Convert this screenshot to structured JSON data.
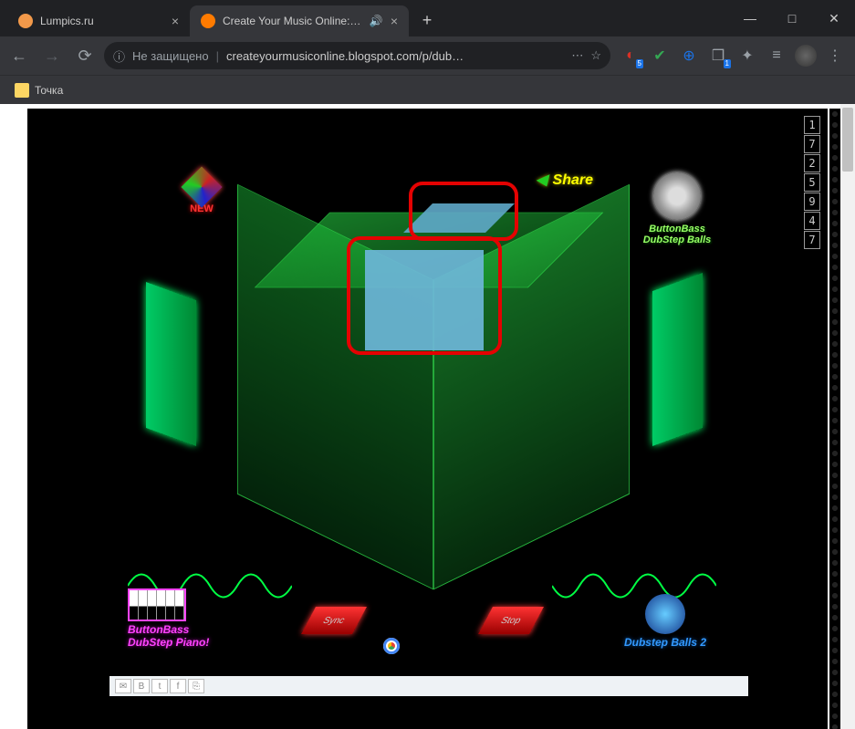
{
  "window": {
    "tabs": [
      {
        "title": "Lumpics.ru",
        "active": false,
        "muted": false,
        "favicon": "#f2994a"
      },
      {
        "title": "Create Your Music Online: Du",
        "active": true,
        "muted": true,
        "favicon": "#ff7b00"
      }
    ],
    "controls": {
      "min": "—",
      "max": "□",
      "close": "✕"
    }
  },
  "toolbar": {
    "back": "←",
    "forward": "→",
    "reload": "⟳",
    "security_icon": "ⓘ",
    "security_label": "Не защищено",
    "url": "createyourmusiconline.blogspot.com/p/dub…",
    "actions_label": "⋯",
    "star": "☆",
    "ext_badges": {
      "blocker": "5",
      "cube": "1"
    },
    "menu": "⋮"
  },
  "bookmarks": {
    "items": [
      {
        "label": "Точка"
      }
    ]
  },
  "page": {
    "counter_digits": [
      "1",
      "7",
      "2",
      "5",
      "9",
      "4",
      "7"
    ],
    "new_label": "NEW",
    "share_label": "Share",
    "buttonbass_balls": {
      "line1": "ButtonBass",
      "line2": "DubStep Balls"
    },
    "piano_link": {
      "line1": "ButtonBass",
      "line2": "DubStep Piano!"
    },
    "balls2_link": "Dubstep Balls 2",
    "sync_label": "Sync",
    "stop_label": "Stop",
    "post_icons": [
      "✉",
      "B",
      "t",
      "f",
      "⎘"
    ]
  }
}
